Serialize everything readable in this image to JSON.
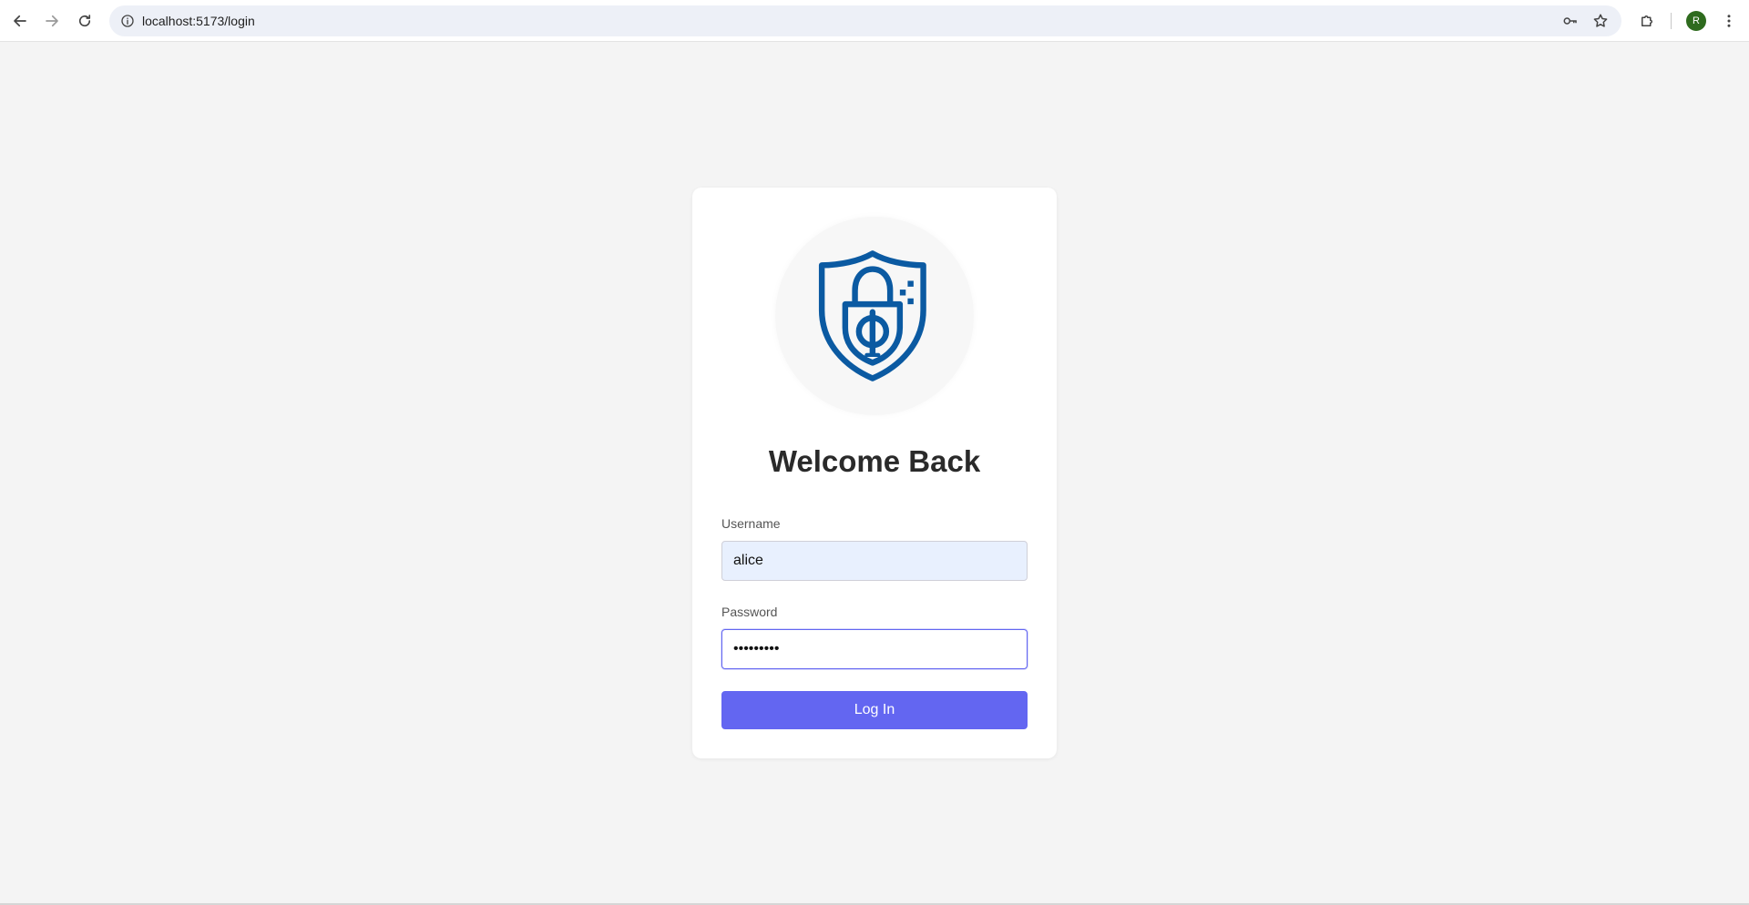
{
  "browser": {
    "url": "localhost:5173/login",
    "profile_initial": "R",
    "icons": {
      "back": "arrow-left-icon",
      "forward": "arrow-right-icon",
      "reload": "reload-icon",
      "site_info": "info-circle-icon",
      "password_key": "key-icon",
      "bookmark": "star-icon",
      "extensions": "puzzle-icon",
      "menu": "kebab-menu-icon"
    },
    "colors": {
      "omnibox_bg": "#edf0f7",
      "avatar_bg": "#2e6b1e"
    }
  },
  "login": {
    "logo": "shield-lock-phi-icon",
    "title": "Welcome Back",
    "username_label": "Username",
    "username_value": "alice",
    "password_label": "Password",
    "password_value": "•••••••••",
    "submit_label": "Log In",
    "colors": {
      "accent": "#6366f1",
      "logo": "#0b5aa2",
      "page_bg": "#f4f4f4"
    }
  }
}
